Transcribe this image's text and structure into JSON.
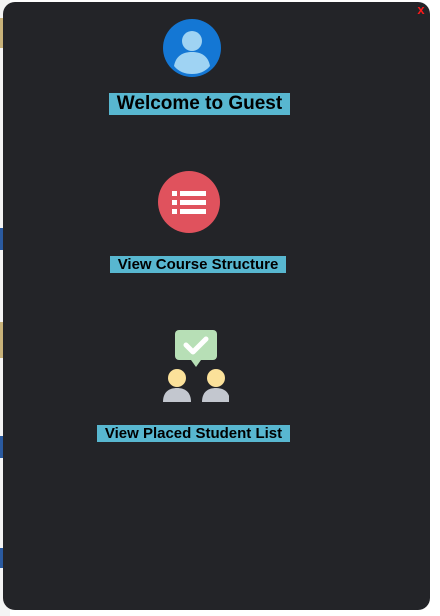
{
  "modal": {
    "close_label": "x",
    "welcome_text": "Welcome to Guest",
    "course_link_label": "View Course Structure",
    "placed_link_label": "View Placed Student List"
  },
  "icons": {
    "avatar": "user-avatar-icon",
    "course": "list-icon",
    "placed": "placed-students-icon"
  },
  "colors": {
    "panel_bg": "#232428",
    "label_bg": "#58b7d0",
    "close": "#ff1a1a",
    "avatar_blue": "#1477d4",
    "list_red": "#e0525d",
    "check_green": "#b7dfb6"
  }
}
